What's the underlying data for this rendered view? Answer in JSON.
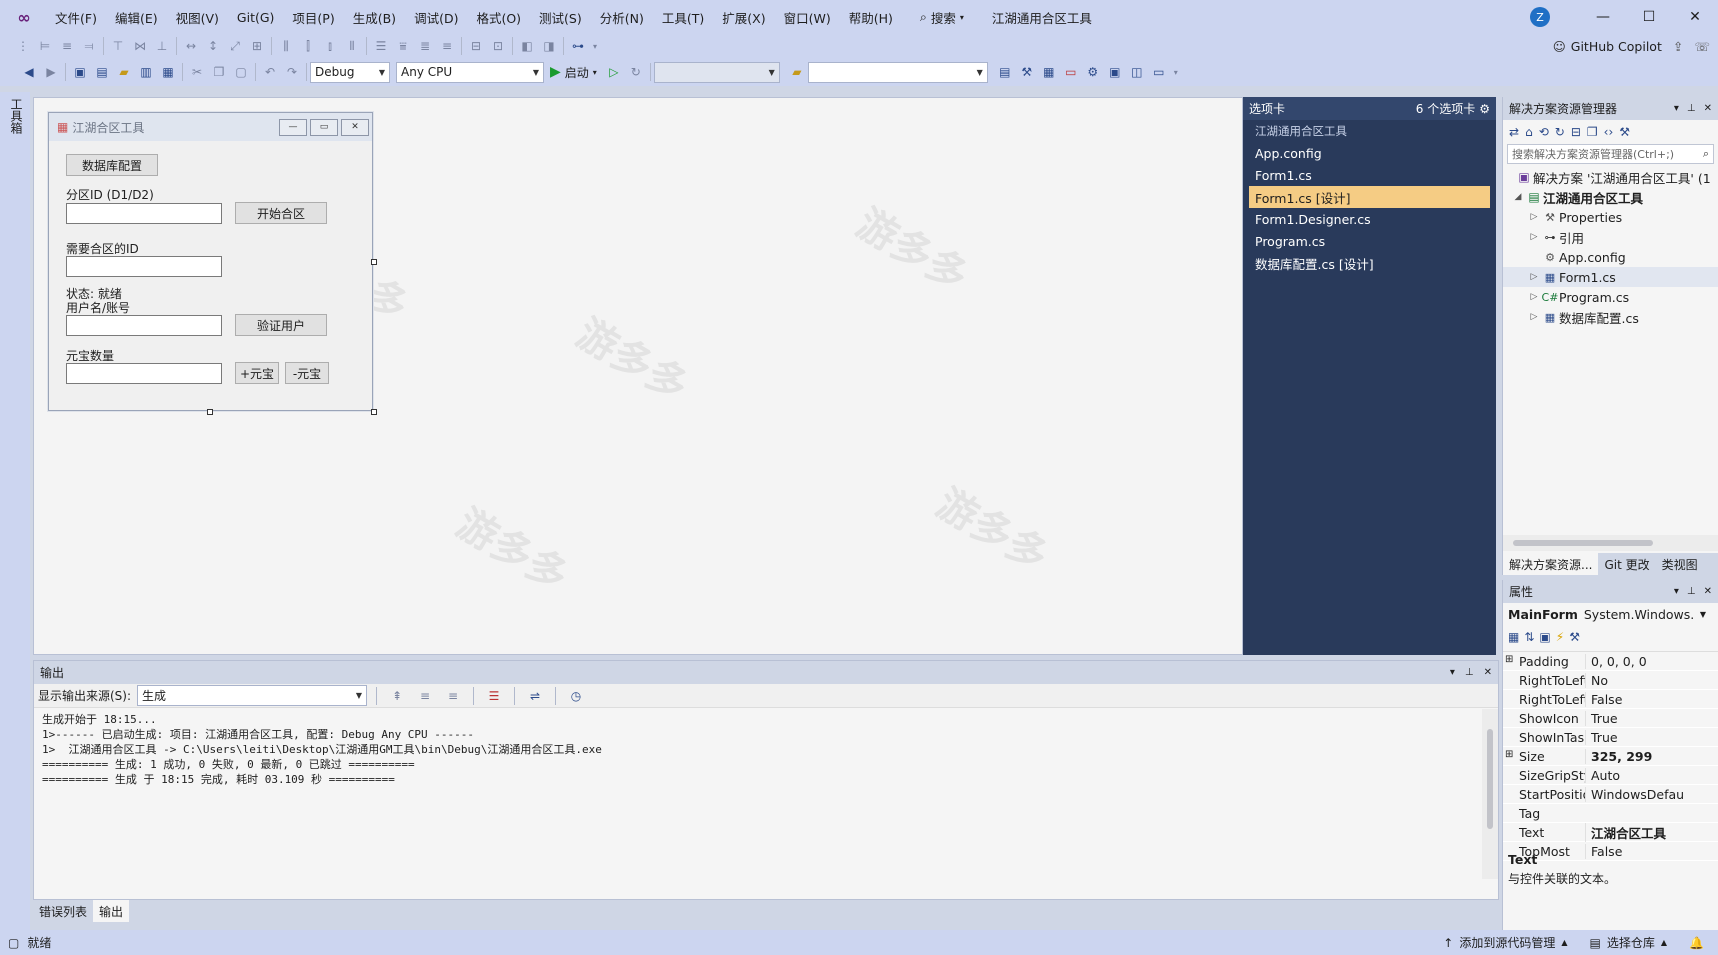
{
  "window": {
    "app_title": "江湖通用合区工具",
    "avatar": "Z"
  },
  "menu": [
    "文件(F)",
    "编辑(E)",
    "视图(V)",
    "Git(G)",
    "项目(P)",
    "生成(B)",
    "调试(D)",
    "格式(O)",
    "测试(S)",
    "分析(N)",
    "工具(T)",
    "扩展(X)",
    "窗口(W)",
    "帮助(H)"
  ],
  "search": {
    "label": "搜索"
  },
  "copilot": {
    "label": "GitHub Copilot"
  },
  "toolbar": {
    "config": "Debug",
    "platform": "Any CPU",
    "start": "启动"
  },
  "leftstrip": {
    "label": "工具箱"
  },
  "form": {
    "title": "江湖合区工具",
    "db_button": "数据库配置",
    "zone_label": "分区ID (D1/D2)",
    "start_button": "开始合区",
    "merge_id_label": "需要合区的ID",
    "status_label": "状态: 就绪",
    "user_label": "用户名/账号",
    "verify_button": "验证用户",
    "yuanbao_label": "元宝数量",
    "add_button": "+元宝",
    "sub_button": "-元宝"
  },
  "toolbox": {
    "title": "选项卡",
    "count": "6 个选项卡",
    "group": "江湖通用合区工具",
    "items": [
      "App.config",
      "Form1.cs",
      "Form1.cs [设计]",
      "Form1.Designer.cs",
      "Program.cs",
      "数据库配置.cs [设计]"
    ]
  },
  "solution_explorer": {
    "title": "解决方案资源管理器",
    "search_placeholder": "搜索解决方案资源管理器(Ctrl+;)",
    "solution": "解决方案 '江湖通用合区工具' (1",
    "project": "江湖通用合区工具",
    "items": [
      "Properties",
      "引用",
      "App.config",
      "Form1.cs",
      "Program.cs",
      "数据库配置.cs"
    ],
    "tabs": [
      "解决方案资源...",
      "Git 更改",
      "类视图"
    ]
  },
  "properties": {
    "title": "属性",
    "object": "MainForm",
    "type": "System.Windows.Fo",
    "rows": [
      {
        "name": "Padding",
        "value": "0, 0, 0, 0"
      },
      {
        "name": "RightToLeft",
        "value": "No"
      },
      {
        "name": "RightToLeftLa",
        "value": "False"
      },
      {
        "name": "ShowIcon",
        "value": "True"
      },
      {
        "name": "ShowInTaskb",
        "value": "True"
      },
      {
        "name": "Size",
        "value": "325, 299"
      },
      {
        "name": "SizeGripStyle",
        "value": "Auto"
      },
      {
        "name": "StartPosition",
        "value": "WindowsDefau"
      },
      {
        "name": "Tag",
        "value": ""
      },
      {
        "name": "Text",
        "value": "江湖合区工具"
      },
      {
        "name": "TopMost",
        "value": "False"
      }
    ],
    "desc_title": "Text",
    "desc_text": "与控件关联的文本。"
  },
  "output": {
    "title": "输出",
    "source_label": "显示输出来源(S):",
    "source_value": "生成",
    "lines": [
      "生成开始于 18:15...",
      "1>------ 已启动生成: 项目: 江湖通用合区工具, 配置: Debug Any CPU ------",
      "1>  江湖通用合区工具 -> C:\\Users\\leiti\\Desktop\\江湖通用GM工具\\bin\\Debug\\江湖通用合区工具.exe",
      "========== 生成: 1 成功, 0 失败, 0 最新, 0 已跳过 ==========",
      "========== 生成 于 18:15 完成, 耗时 03.109 秒 =========="
    ],
    "tabs": [
      "错误列表",
      "输出"
    ]
  },
  "status": {
    "ready": "就绪",
    "source_control": "添加到源代码管理",
    "repo": "选择仓库"
  }
}
